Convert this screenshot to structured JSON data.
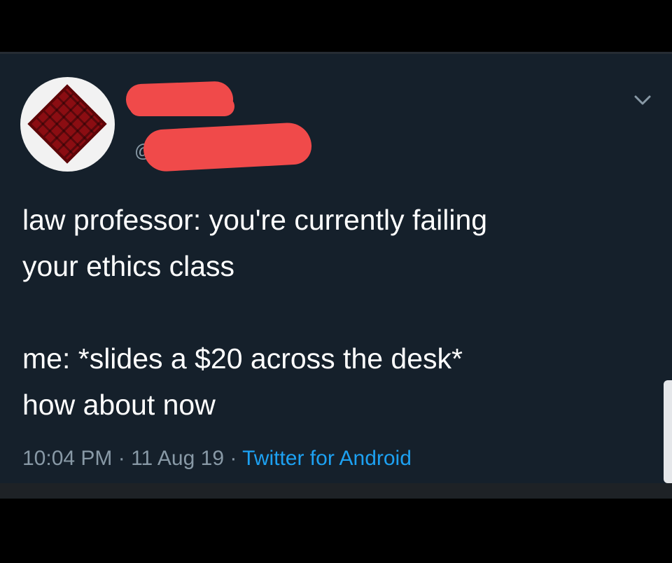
{
  "tweet": {
    "handle_prefix": "@",
    "text_lines": [
      "law professor: you're currently failing",
      "your ethics class",
      "",
      "me: *slides a $20 across the desk*",
      "how about now"
    ],
    "time": "10:04 PM",
    "separator": " · ",
    "date": "11 Aug 19",
    "source": "Twitter for Android"
  },
  "icons": {
    "menu": "chevron-down-icon",
    "avatar": "avatar"
  },
  "colors": {
    "background": "#15202b",
    "text": "#ffffff",
    "meta": "#8899a6",
    "link": "#1da1f2",
    "redaction": "#f04a4a"
  }
}
